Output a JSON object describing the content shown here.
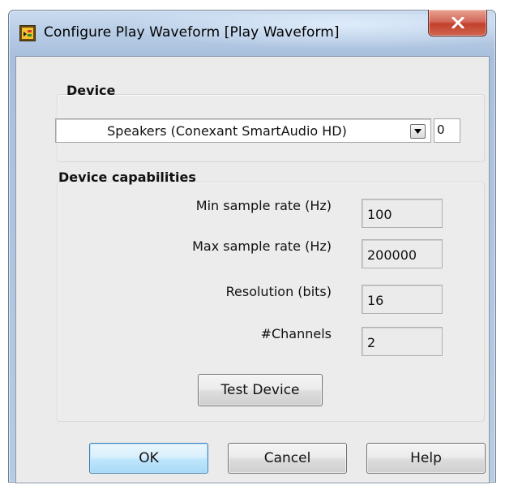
{
  "window": {
    "title": "Configure Play Waveform [Play Waveform]"
  },
  "device_group": {
    "title": "Device",
    "selected_device": "Speakers (Conexant SmartAudio HD)",
    "device_index": "0"
  },
  "capabilities_group": {
    "title": "Device capabilities",
    "rows": [
      {
        "label": "Min sample rate (Hz)",
        "value": "100"
      },
      {
        "label": "Max sample rate (Hz)",
        "value": "200000"
      },
      {
        "label": "Resolution (bits)",
        "value": "16"
      },
      {
        "label": "#Channels",
        "value": "2"
      }
    ],
    "test_button": "Test Device"
  },
  "buttons": {
    "ok": "OK",
    "cancel": "Cancel",
    "help": "Help"
  },
  "icons": {
    "app": "labview-waveform-icon",
    "close": "close-icon",
    "dropdown": "chevron-down-icon"
  },
  "colors": {
    "close_button": "#c2412d",
    "default_button_border": "#3c7fb1",
    "window_frame": "#b6cbe5"
  }
}
